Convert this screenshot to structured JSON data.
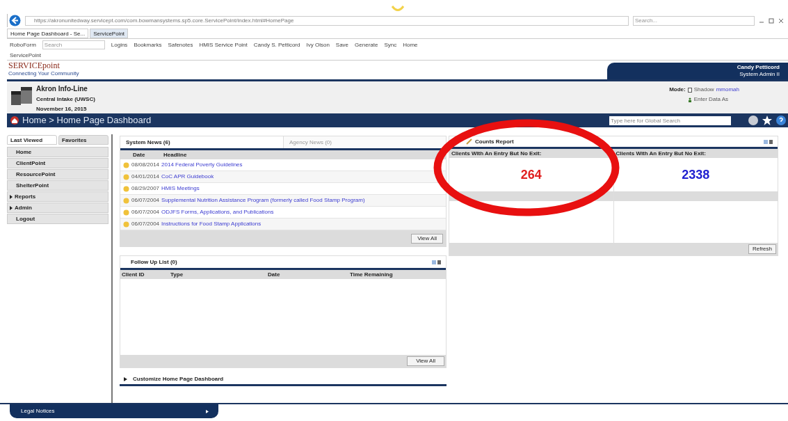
{
  "browser": {
    "address": "https://akronunitedway.servicept.com/com.bowmansystems.sp5.core.ServicePoint/index.html#HomePage",
    "search": {
      "placeholder": "Search..."
    },
    "tabs": [
      {
        "label": "Home Page Dashboard - Se...",
        "selected": true
      },
      {
        "label": "ServicePoint",
        "selected": false
      }
    ],
    "toolbar": [
      "RoboForm",
      "Logins",
      "Bookmarks",
      "Safenotes",
      "HMIS Service Point",
      "Candy S. Petticord",
      "Ivy Olson",
      "Save",
      "Generate",
      "Sync",
      "Home"
    ],
    "toolbar_search": {
      "placeholder": "Search"
    },
    "favorites": [
      "ServicePoint"
    ]
  },
  "header": {
    "logo": "SERVICEpoint",
    "tagline": "Connecting Your Community",
    "user": "Candy Petticord",
    "role": "System Admin II"
  },
  "org": {
    "name": "Akron Info-Line",
    "unit": "Central Intake (UWSC)",
    "date": "November 16, 2015",
    "mode_label": "Mode:",
    "shadow_label": "Shadow",
    "shadow_user": "mmomah",
    "enter_data_as": "Enter Data As"
  },
  "breadcrumb": "Home > Home Page Dashboard",
  "global_search": {
    "placeholder": "Type here for Global Search"
  },
  "sidebar": {
    "tabs": [
      {
        "label": "Last Viewed",
        "selected": true
      },
      {
        "label": "Favorites",
        "selected": false
      }
    ],
    "items": [
      {
        "label": "Home",
        "kind": "link"
      },
      {
        "label": "ClientPoint",
        "kind": "link"
      },
      {
        "label": "ResourcePoint",
        "kind": "link"
      },
      {
        "label": "ShelterPoint",
        "kind": "link"
      },
      {
        "label": "Reports",
        "kind": "group"
      },
      {
        "label": "Admin",
        "kind": "group"
      },
      {
        "label": "Logout",
        "kind": "link"
      }
    ]
  },
  "news": {
    "tabs": [
      {
        "label": "System News (6)",
        "selected": true
      },
      {
        "label": "Agency News (0)",
        "selected": false
      }
    ],
    "columns": [
      "Date",
      "Headline"
    ],
    "rows": [
      {
        "date": "08/08/2014",
        "headline": "2014 Federal Poverty Guidelines"
      },
      {
        "date": "04/01/2014",
        "headline": "CoC APR Guidebook"
      },
      {
        "date": "08/29/2007",
        "headline": "HMIS Meetings"
      },
      {
        "date": "06/07/2004",
        "headline": "Supplemental Nutrition Assistance Program (formerly called Food Stamp Program)"
      },
      {
        "date": "06/07/2004",
        "headline": "ODJFS Forms, Applications, and Publications"
      },
      {
        "date": "06/07/2004",
        "headline": "Instructions for Food Stamp Applications"
      }
    ],
    "button": "View All"
  },
  "follow_up": {
    "title": "Follow Up List (0)",
    "columns": [
      "Client ID",
      "Type",
      "Date",
      "Time Remaining"
    ],
    "button": "View All"
  },
  "customize": "Customize Home Page Dashboard",
  "counts": {
    "title": "Counts Report",
    "items": [
      {
        "label": "Clients With An Entry But No Exit:",
        "value": "264",
        "color": "#e02020"
      },
      {
        "label": "Clients With An Entry But No Exit:",
        "value": "2338",
        "color": "#2020d0"
      }
    ],
    "button": "Refresh"
  },
  "footer": "Legal Notices"
}
